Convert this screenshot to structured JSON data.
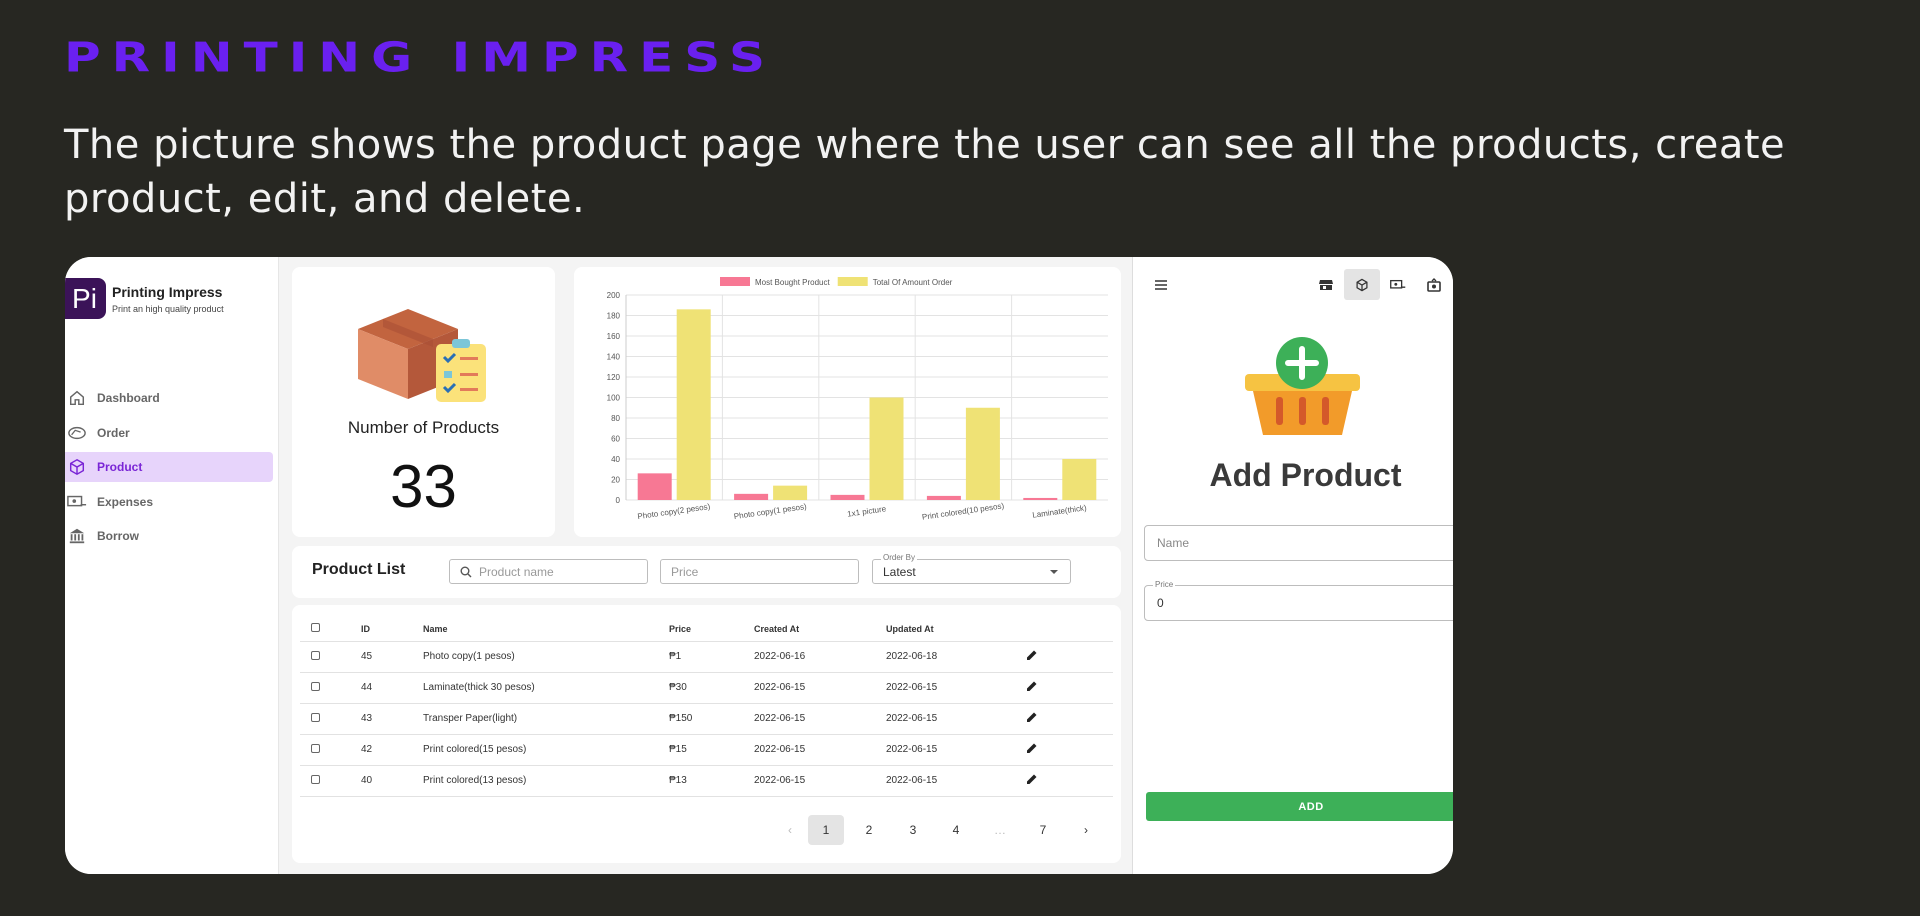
{
  "headline": "PRINTING IMPRESS",
  "description": "The picture shows the product page where the user can see all the products, create product, edit, and delete.",
  "brand": {
    "logo_text": "Pi",
    "name": "Printing Impress",
    "tagline": "Print an high quality product"
  },
  "sidebar": {
    "items": [
      {
        "label": "Dashboard",
        "icon": "home-icon",
        "active": false
      },
      {
        "label": "Order",
        "icon": "order-icon",
        "active": false
      },
      {
        "label": "Product",
        "icon": "cube-icon",
        "active": true
      },
      {
        "label": "Expenses",
        "icon": "expenses-icon",
        "active": false
      },
      {
        "label": "Borrow",
        "icon": "bank-icon",
        "active": false
      }
    ]
  },
  "summary": {
    "title": "Number of Products",
    "value": "33"
  },
  "chart_data": {
    "type": "bar",
    "categories": [
      "Photo copy(2 pesos)",
      "Photo copy(1 pesos)",
      "1x1 picture",
      "Print colored(10 pesos)",
      "Laminate(thick)"
    ],
    "series": [
      {
        "name": "Most Bought Product",
        "color": "#f77894",
        "values": [
          26,
          6,
          5,
          4,
          2
        ]
      },
      {
        "name": "Total Of Amount Order",
        "color": "#efe275",
        "values": [
          186,
          14,
          100,
          90,
          40
        ]
      }
    ],
    "ylim": [
      0,
      200
    ],
    "yticks": [
      "0",
      "20",
      "40",
      "60",
      "80",
      "100",
      "120",
      "140",
      "160",
      "180",
      "200"
    ],
    "grid": true,
    "legend": "top-center"
  },
  "product_list": {
    "title": "Product List",
    "search_placeholder": "Product name",
    "price_placeholder": "Price",
    "order_by_label": "Order By",
    "order_by_value": "Latest"
  },
  "table": {
    "headers": {
      "id": "ID",
      "name": "Name",
      "price": "Price",
      "created": "Created At",
      "updated": "Updated At"
    },
    "rows": [
      {
        "id": "45",
        "name": "Photo copy(1 pesos)",
        "price": "₱1",
        "created": "2022-06-16",
        "updated": "2022-06-18"
      },
      {
        "id": "44",
        "name": "Laminate(thick 30 pesos)",
        "price": "₱30",
        "created": "2022-06-15",
        "updated": "2022-06-15"
      },
      {
        "id": "43",
        "name": "Transper Paper(light)",
        "price": "₱150",
        "created": "2022-06-15",
        "updated": "2022-06-15"
      },
      {
        "id": "42",
        "name": "Print colored(15 pesos)",
        "price": "₱15",
        "created": "2022-06-15",
        "updated": "2022-06-15"
      },
      {
        "id": "40",
        "name": "Print colored(13 pesos)",
        "price": "₱13",
        "created": "2022-06-15",
        "updated": "2022-06-15"
      }
    ]
  },
  "pagination": {
    "prev": "‹",
    "pages": [
      "1",
      "2",
      "3",
      "4"
    ],
    "ellipsis": "…",
    "last": "7",
    "next": "›",
    "current": "1"
  },
  "panel": {
    "title": "Add Product",
    "name_placeholder": "Name",
    "price_label": "Price",
    "price_value": "0",
    "add_label": "ADD"
  },
  "colors": {
    "accent": "#7a25d6",
    "headline": "#6a20f0",
    "background": "#272722",
    "add_button": "#3db058"
  }
}
